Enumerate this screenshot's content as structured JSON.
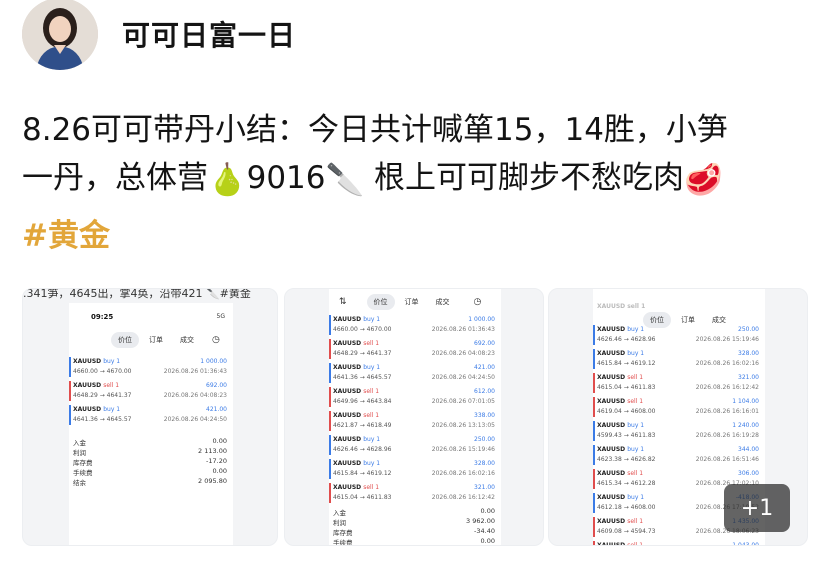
{
  "author": {
    "name": "可可日富一日"
  },
  "post": {
    "line1": "8.26可可带丹小结：今日共计喊箪15，14胜，小笋",
    "line2a": "一丹，总体营",
    "line2b": "9016",
    "line2c": "根上可可脚步不愁吃肉",
    "tag": "#黄金",
    "emoji": {
      "pear": "🍐",
      "knife": "🔪",
      "meat": "🥩"
    }
  },
  "images": {
    "more_badge": "+1",
    "shot1": {
      "cut_text": ".341笋，4645出，掌4奂，沿带421 🔪#黄金",
      "time": "09:25",
      "status": "5G",
      "tabs": [
        "价位",
        "订单",
        "成交"
      ],
      "rows": [
        {
          "sym": "XAUUSD",
          "side": "buy 1",
          "type": "buy",
          "px": "4660.00 → 4670.00",
          "pl": "1 000.00",
          "dt": "2026.08.26 01:36:43"
        },
        {
          "sym": "XAUUSD",
          "side": "sell 1",
          "type": "sell",
          "px": "4648.29 → 4641.37",
          "pl": "692.00",
          "dt": "2026.08.26 04:08:23"
        },
        {
          "sym": "XAUUSD",
          "side": "buy 1",
          "type": "buy",
          "px": "4641.36 → 4645.57",
          "pl": "421.00",
          "dt": "2026.08.26 04:24:50"
        }
      ],
      "summary": [
        {
          "k": "入金",
          "v": "0.00"
        },
        {
          "k": "利润",
          "v": "2 113.00"
        },
        {
          "k": "库存费",
          "v": "-17.20"
        },
        {
          "k": "手续费",
          "v": "0.00"
        },
        {
          "k": "结余",
          "v": "2 095.80"
        }
      ]
    },
    "shot2": {
      "tabs": [
        "价位",
        "订单",
        "成交"
      ],
      "rows": [
        {
          "sym": "XAUUSD",
          "side": "buy 1",
          "type": "buy",
          "px": "4660.00 → 4670.00",
          "pl": "1 000.00",
          "dt": "2026.08.26 01:36:43"
        },
        {
          "sym": "XAUUSD",
          "side": "sell 1",
          "type": "sell",
          "px": "4648.29 → 4641.37",
          "pl": "692.00",
          "dt": "2026.08.26 04:08:23"
        },
        {
          "sym": "XAUUSD",
          "side": "buy 1",
          "type": "buy",
          "px": "4641.36 → 4645.57",
          "pl": "421.00",
          "dt": "2026.08.26 04:24:50"
        },
        {
          "sym": "XAUUSD",
          "side": "sell 1",
          "type": "sell",
          "px": "4649.96 → 4643.84",
          "pl": "612.00",
          "dt": "2026.08.26 07:01:05"
        },
        {
          "sym": "XAUUSD",
          "side": "sell 1",
          "type": "sell",
          "px": "4621.87 → 4618.49",
          "pl": "338.00",
          "dt": "2026.08.26 13:13:05"
        },
        {
          "sym": "XAUUSD",
          "side": "buy 1",
          "type": "buy",
          "px": "4626.46 → 4628.96",
          "pl": "250.00",
          "dt": "2026.08.26 15:19:46"
        },
        {
          "sym": "XAUUSD",
          "side": "buy 1",
          "type": "buy",
          "px": "4615.84 → 4619.12",
          "pl": "328.00",
          "dt": "2026.08.26 16:02:16"
        },
        {
          "sym": "XAUUSD",
          "side": "sell 1",
          "type": "sell",
          "px": "4615.04 → 4611.83",
          "pl": "321.00",
          "dt": "2026.08.26 16:12:42"
        }
      ],
      "summary": [
        {
          "k": "入金",
          "v": "0.00"
        },
        {
          "k": "利润",
          "v": "3 962.00"
        },
        {
          "k": "库存费",
          "v": "-34.40"
        },
        {
          "k": "手续费",
          "v": "0.00"
        }
      ]
    },
    "shot3": {
      "tabs": [
        "价位",
        "订单",
        "成交"
      ],
      "top_cut": "XAUUSD sell 1",
      "rows": [
        {
          "sym": "XAUUSD",
          "side": "buy 1",
          "type": "buy",
          "px": "4626.46 → 4628.96",
          "pl": "250.00",
          "dt": "2026.08.26 15:19:46"
        },
        {
          "sym": "XAUUSD",
          "side": "buy 1",
          "type": "buy",
          "px": "4615.84 → 4619.12",
          "pl": "328.00",
          "dt": "2026.08.26 16:02:16"
        },
        {
          "sym": "XAUUSD",
          "side": "sell 1",
          "type": "sell",
          "px": "4615.04 → 4611.83",
          "pl": "321.00",
          "dt": "2026.08.26 16:12:42"
        },
        {
          "sym": "XAUUSD",
          "side": "sell 1",
          "type": "sell",
          "px": "4619.04 → 4608.00",
          "pl": "1 104.00",
          "dt": "2026.08.26 16:16:01"
        },
        {
          "sym": "XAUUSD",
          "side": "buy 1",
          "type": "buy",
          "px": "4599.43 → 4611.83",
          "pl": "1 240.00",
          "dt": "2026.08.26 16:19:28"
        },
        {
          "sym": "XAUUSD",
          "side": "buy 1",
          "type": "buy",
          "px": "4623.38 → 4626.82",
          "pl": "344.00",
          "dt": "2026.08.26 16:51:46"
        },
        {
          "sym": "XAUUSD",
          "side": "sell 1",
          "type": "sell",
          "px": "4615.34 → 4612.28",
          "pl": "306.00",
          "dt": "2026.08.26 17:02:10"
        },
        {
          "sym": "XAUUSD",
          "side": "buy 1",
          "type": "buy",
          "px": "4612.18 → 4608.00",
          "pl": "-418.00",
          "dt": "2026.08.26 17:10:52"
        },
        {
          "sym": "XAUUSD",
          "side": "sell 1",
          "type": "sell",
          "px": "4609.08 → 4594.73",
          "pl": "1 435.00",
          "dt": "2026.08.26 18:06:23"
        },
        {
          "sym": "XAUUSD",
          "side": "sell 1",
          "type": "sell",
          "px": "",
          "pl": "1 043.00",
          "dt": ""
        }
      ]
    }
  }
}
